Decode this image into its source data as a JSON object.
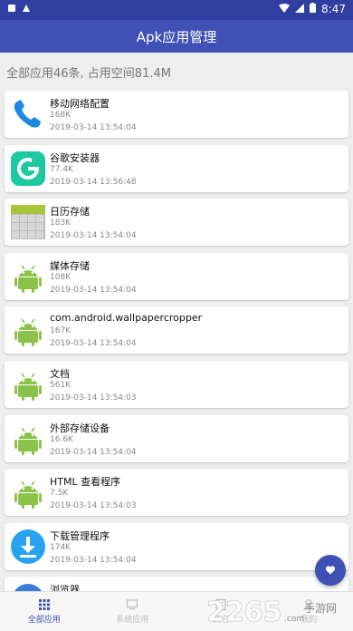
{
  "status": {
    "time": "8:47"
  },
  "appbar": {
    "title": "Apk应用管理"
  },
  "summary": "全部应用46条, 占用空间81.4M",
  "apps": [
    {
      "name": "移动网络配置",
      "size": "168K",
      "date": "2019-03-14 13:54:04",
      "icon": "phone-icon"
    },
    {
      "name": "谷歌安装器",
      "size": "77.4K",
      "date": "2019-03-14 13:56:48",
      "icon": "google-installer-icon"
    },
    {
      "name": "日历存储",
      "size": "183K",
      "date": "2019-03-14 13:54:04",
      "icon": "calendar-storage-icon"
    },
    {
      "name": "媒体存储",
      "size": "108K",
      "date": "2019-03-14 13:54:04",
      "icon": "android-icon"
    },
    {
      "name": "com.android.wallpapercropper",
      "size": "167K",
      "date": "2019-03-14 13:54:04",
      "icon": "android-icon"
    },
    {
      "name": "文档",
      "size": "561K",
      "date": "2019-03-14 13:54:03",
      "icon": "android-icon"
    },
    {
      "name": "外部存储设备",
      "size": "16.6K",
      "date": "2019-03-14 13:54:04",
      "icon": "android-icon"
    },
    {
      "name": "HTML 查看程序",
      "size": "7.5K",
      "date": "2019-03-14 13:54:03",
      "icon": "android-icon"
    },
    {
      "name": "下载管理程序",
      "size": "174K",
      "date": "2019-03-14 13:54:04",
      "icon": "download-icon"
    },
    {
      "name": "浏览器",
      "size": "",
      "date": "",
      "icon": "browser-icon"
    }
  ],
  "bottom_nav": [
    {
      "label": "全部应用",
      "icon": "grid-icon",
      "active": true
    },
    {
      "label": "系统应用",
      "icon": "monitor-icon",
      "active": false
    },
    {
      "label": "其它",
      "icon": "other-icon",
      "active": false
    },
    {
      "label": "我的",
      "icon": "user-icon",
      "active": false
    }
  ],
  "watermark": {
    "number": "2265",
    "suffix": ".com",
    "site": "手游网"
  },
  "colors": {
    "primary": "#3f51b5",
    "primary_dark": "#303f9f",
    "background": "#eeeeee"
  }
}
